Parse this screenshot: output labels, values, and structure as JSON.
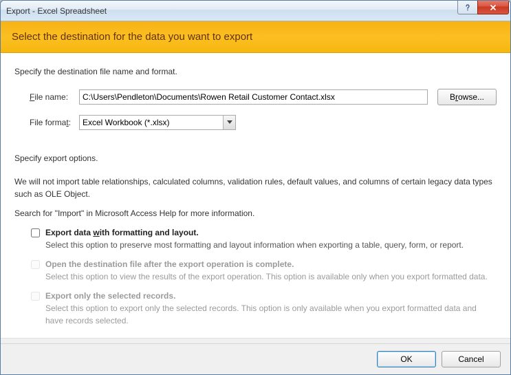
{
  "window": {
    "title": "Export - Excel Spreadsheet"
  },
  "banner": {
    "heading": "Select the destination for the data you want to export"
  },
  "section1": {
    "label": "Specify the destination file name and format.",
    "filename_label_pre": "",
    "filename_key": "F",
    "filename_label_post": "ile name:",
    "filename_value": "C:\\Users\\Pendleton\\Documents\\Rowen Retail Customer Contact.xlsx",
    "browse_pre": "B",
    "browse_key": "r",
    "browse_post": "owse...",
    "format_label_pre": "File forma",
    "format_key": "t",
    "format_label_post": ":",
    "format_value": "Excel Workbook (*.xlsx)"
  },
  "section2": {
    "label": "Specify export options.",
    "info1": "We will not import table relationships, calculated columns, validation rules, default values, and columns of certain legacy data types such as OLE Object.",
    "info2": "Search for \"Import\" in Microsoft Access Help for more information.",
    "opt1_pre": "Export data ",
    "opt1_key": "w",
    "opt1_post": "ith formatting and layout.",
    "opt1_desc": "Select this option to preserve most formatting and layout information when exporting a table, query, form, or report.",
    "opt2_pre": "Open the destination file after the export operation is complete",
    "opt2_key": "",
    "opt2_post": ".",
    "opt2_desc": "Select this option to view the results of the export operation. This option is available only when you export formatted data.",
    "opt3_pre": "Export only the selected records",
    "opt3_key": "",
    "opt3_post": ".",
    "opt3_desc": "Select this option to export only the selected records. This option is only available when you export formatted data and have records selected."
  },
  "footer": {
    "ok": "OK",
    "cancel": "Cancel"
  }
}
